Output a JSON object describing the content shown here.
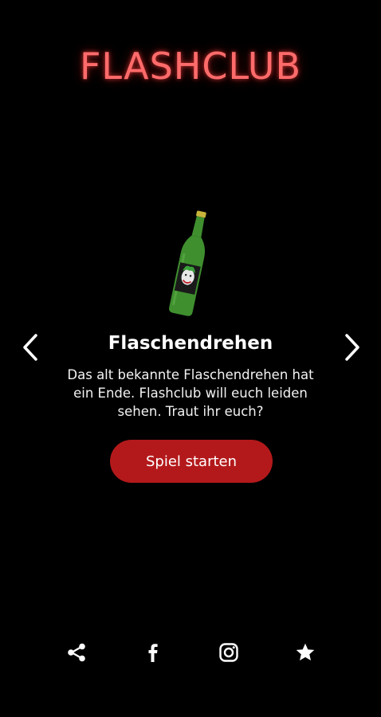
{
  "app": {
    "logo_text": "FLASHCLUB",
    "accent_color": "#ff6b6b",
    "button_color": "#b3191b",
    "background_color": "#000000"
  },
  "game": {
    "title": "Flaschendrehen",
    "description": "Das alt bekannte Flaschendrehen hat ein Ende. Flashclub will euch leiden sehen. Traut ihr euch?",
    "start_label": "Spiel starten",
    "image_icon": "green-bottle-with-joker-label"
  },
  "navigation": {
    "prev_icon": "chevron-left-icon",
    "next_icon": "chevron-right-icon"
  },
  "footer": {
    "icons": [
      "share-icon",
      "facebook-icon",
      "instagram-icon",
      "star-icon"
    ]
  }
}
